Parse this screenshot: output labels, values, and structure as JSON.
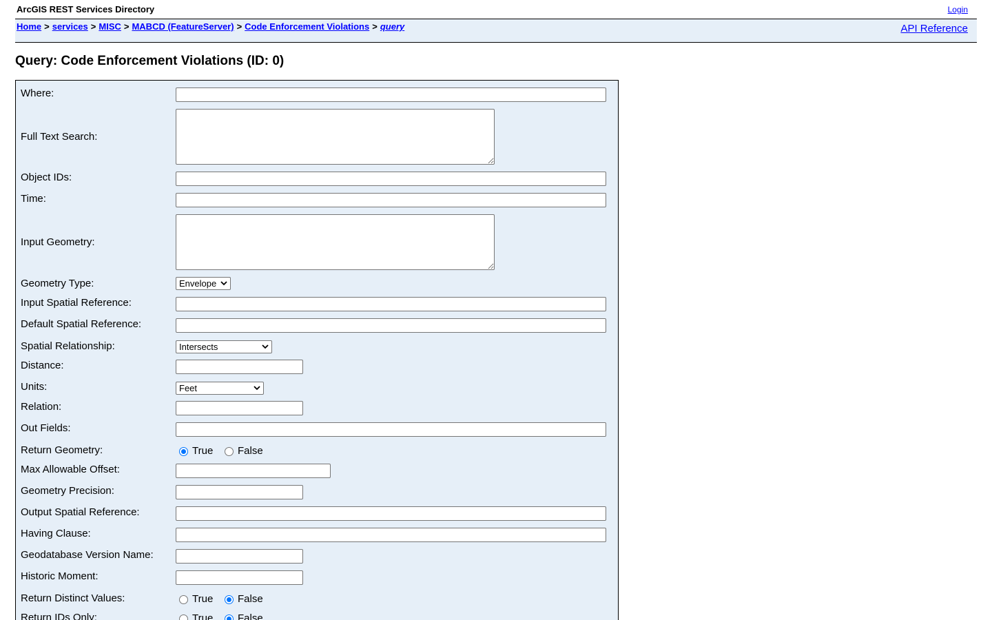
{
  "header": {
    "app_title": "ArcGIS REST Services Directory",
    "login_label": "Login"
  },
  "breadcrumb": {
    "items": [
      "Home",
      "services",
      "MISC",
      "MABCD (FeatureServer)",
      "Code Enforcement Violations",
      "query"
    ],
    "separator": ">"
  },
  "api_reference_label": "API Reference",
  "page_title": "Query: Code Enforcement Violations (ID: 0)",
  "form": {
    "where": {
      "label": "Where:",
      "value": ""
    },
    "full_text_search": {
      "label": "Full Text Search:",
      "value": ""
    },
    "object_ids": {
      "label": "Object IDs:",
      "value": ""
    },
    "time": {
      "label": "Time:",
      "value": ""
    },
    "input_geometry": {
      "label": "Input Geometry:",
      "value": ""
    },
    "geometry_type": {
      "label": "Geometry Type:",
      "selected": "Envelope"
    },
    "input_spatial_reference": {
      "label": "Input Spatial Reference:",
      "value": ""
    },
    "default_spatial_reference": {
      "label": "Default Spatial Reference:",
      "value": ""
    },
    "spatial_relationship": {
      "label": "Spatial Relationship:",
      "selected": "Intersects"
    },
    "distance": {
      "label": "Distance:",
      "value": ""
    },
    "units": {
      "label": "Units:",
      "selected": "Feet"
    },
    "relation": {
      "label": "Relation:",
      "value": ""
    },
    "out_fields": {
      "label": "Out Fields:",
      "value": ""
    },
    "return_geometry": {
      "label": "Return Geometry:",
      "true_label": "True",
      "false_label": "False",
      "selected": "True"
    },
    "max_allowable_offset": {
      "label": "Max Allowable Offset:",
      "value": ""
    },
    "geometry_precision": {
      "label": "Geometry Precision:",
      "value": ""
    },
    "output_spatial_reference": {
      "label": "Output Spatial Reference:",
      "value": ""
    },
    "having_clause": {
      "label": "Having Clause:",
      "value": ""
    },
    "gdb_version": {
      "label": "Geodatabase Version Name:",
      "value": ""
    },
    "historic_moment": {
      "label": "Historic Moment:",
      "value": ""
    },
    "return_distinct_values": {
      "label": "Return Distinct Values:",
      "true_label": "True",
      "false_label": "False",
      "selected": "False"
    },
    "return_ids_only": {
      "label": "Return IDs Only:",
      "true_label": "True",
      "false_label": "False",
      "selected": "False"
    }
  },
  "colors": {
    "link": "#0000ff",
    "panel_background": "#e6eff8",
    "radio_accent": "#0075ff"
  },
  "icons": {
    "select_arrow": "chevron-down-icon"
  }
}
